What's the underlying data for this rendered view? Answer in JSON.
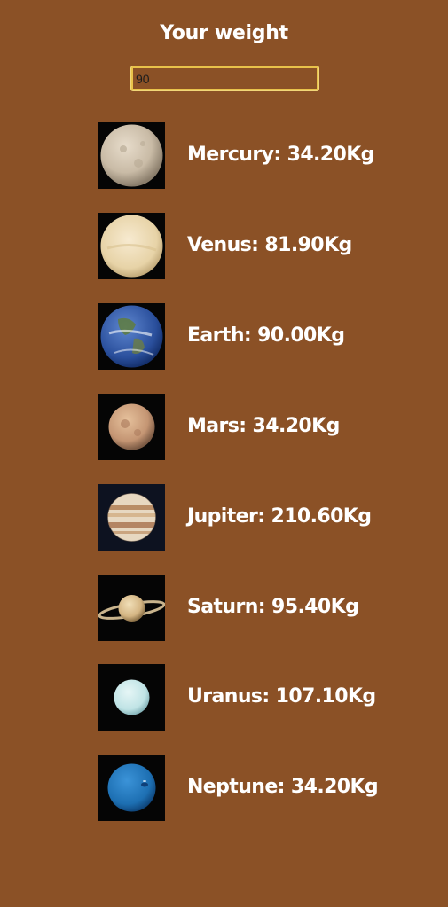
{
  "header": {
    "title": "Your weight"
  },
  "weight_input": {
    "value": "90"
  },
  "planets": [
    {
      "icon": "mercury-icon",
      "label": "Mercury: 34.20Kg"
    },
    {
      "icon": "venus-icon",
      "label": "Venus: 81.90Kg"
    },
    {
      "icon": "earth-icon",
      "label": "Earth: 90.00Kg"
    },
    {
      "icon": "mars-icon",
      "label": "Mars: 34.20Kg"
    },
    {
      "icon": "jupiter-icon",
      "label": "Jupiter: 210.60Kg"
    },
    {
      "icon": "saturn-icon",
      "label": "Saturn: 95.40Kg"
    },
    {
      "icon": "uranus-icon",
      "label": "Uranus: 107.10Kg"
    },
    {
      "icon": "neptune-icon",
      "label": "Neptune: 34.20Kg"
    }
  ],
  "colors": {
    "background": "#8b5126",
    "input_border": "#e8c24a",
    "text": "#ffffff"
  }
}
